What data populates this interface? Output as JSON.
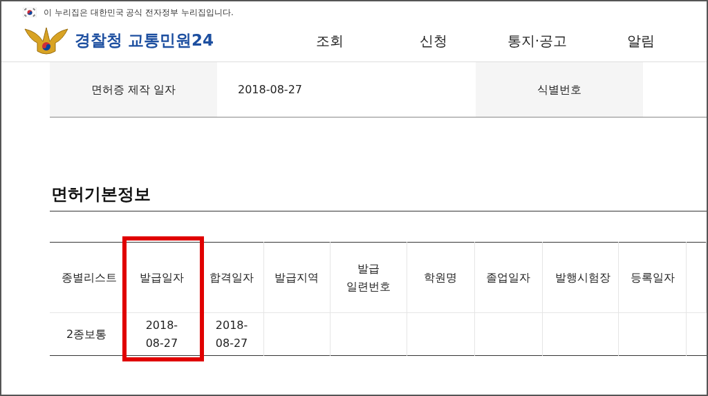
{
  "gov_banner": {
    "text": "이 누리집은 대한민국 공식 전자정부 누리집입니다."
  },
  "logo": {
    "text": "경찰청 교통민원24"
  },
  "nav": [
    {
      "label": "조회"
    },
    {
      "label": "신청"
    },
    {
      "label": "통지·공고"
    },
    {
      "label": "알림"
    }
  ],
  "info_row": [
    {
      "label": "면허증 제작 일자",
      "value": "2018-08-27"
    },
    {
      "label": "식별번호"
    }
  ],
  "section_title": "면허기본정보",
  "table": {
    "columns": [
      {
        "label": "종별리스트",
        "highlighted": false
      },
      {
        "label": "발급일자",
        "highlighted": true
      },
      {
        "label": "합격일자",
        "highlighted": false
      },
      {
        "label": "발급지역",
        "highlighted": false
      },
      {
        "label": "발급 일련번호",
        "highlighted": false
      },
      {
        "label": "학원명",
        "highlighted": false
      },
      {
        "label": "졸업일자",
        "highlighted": false
      },
      {
        "label": "발행시험장",
        "highlighted": false
      },
      {
        "label": "등록일자",
        "highlighted": false
      }
    ],
    "rows": [
      [
        "2종보통",
        "2018-08-27",
        "2018-08-27",
        "",
        "",
        "",
        "",
        "",
        ""
      ]
    ]
  }
}
